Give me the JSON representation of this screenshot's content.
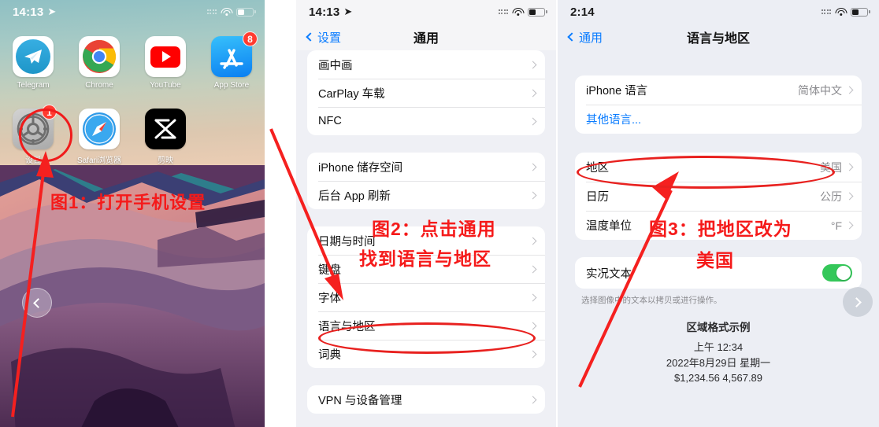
{
  "panels": {
    "home": {
      "status": {
        "time": "14:13",
        "location_icon": "location-arrow-icon"
      },
      "apps_row1": [
        {
          "name": "Telegram",
          "icon": "telegram-icon",
          "badge": ""
        },
        {
          "name": "Chrome",
          "icon": "chrome-icon",
          "badge": ""
        },
        {
          "name": "YouTube",
          "icon": "youtube-icon",
          "badge": ""
        },
        {
          "name": "App Store",
          "icon": "app-store-icon",
          "badge": "8"
        }
      ],
      "apps_row2": [
        {
          "name": "设置",
          "icon": "settings-gear-icon",
          "badge": "1"
        },
        {
          "name": "Safari浏览器",
          "icon": "safari-compass-icon",
          "badge": ""
        },
        {
          "name": "剪映",
          "icon": "jianying-icon",
          "badge": ""
        }
      ],
      "annotation": "图1：打开手机设置",
      "nav_prev_icon": "chevron-left-icon"
    },
    "general": {
      "status": {
        "time": "14:13",
        "location_icon": "location-arrow-icon"
      },
      "back_label": "设置",
      "title": "通用",
      "groups": [
        {
          "rows": [
            {
              "label": "画中画",
              "value": ""
            },
            {
              "label": "CarPlay 车载",
              "value": ""
            },
            {
              "label": "NFC",
              "value": ""
            }
          ]
        },
        {
          "rows": [
            {
              "label": "iPhone 储存空间",
              "value": ""
            },
            {
              "label": "后台 App 刷新",
              "value": ""
            }
          ]
        },
        {
          "rows": [
            {
              "label": "日期与时间",
              "value": ""
            },
            {
              "label": "键盘",
              "value": ""
            },
            {
              "label": "字体",
              "value": ""
            },
            {
              "label": "语言与地区",
              "value": ""
            },
            {
              "label": "词典",
              "value": ""
            }
          ]
        },
        {
          "rows": [
            {
              "label": "VPN 与设备管理",
              "value": ""
            }
          ]
        }
      ],
      "annotation_line1": "图2：点击通用",
      "annotation_line2": "找到语言与地区"
    },
    "lang": {
      "status": {
        "time": "2:14",
        "location_icon": ""
      },
      "back_label": "通用",
      "title": "语言与地区",
      "group_language": [
        {
          "label": "iPhone 语言",
          "value": "简体中文",
          "type": "disclosure"
        },
        {
          "label": "其他语言...",
          "value": "",
          "type": "link"
        }
      ],
      "group_region": [
        {
          "label": "地区",
          "value": "美国",
          "type": "disclosure"
        },
        {
          "label": "日历",
          "value": "公历",
          "type": "disclosure"
        },
        {
          "label": "温度单位",
          "value": "°F",
          "type": "disclosure"
        }
      ],
      "group_livetext": [
        {
          "label": "实况文本",
          "value": "on",
          "type": "toggle"
        }
      ],
      "livetext_footnote": "选择图像中的文本以拷贝或进行操作。",
      "sample": {
        "heading": "区域格式示例",
        "line1": "上午 12:34",
        "line2": "2022年8月29日 星期一",
        "line3": "$1,234.56    4,567.89"
      },
      "annotation_line1": "图3：把地区改为",
      "annotation_line2": "美国",
      "nav_next_icon": "chevron-right-icon"
    }
  },
  "colors": {
    "annotation_red": "#f5201f",
    "ios_blue": "#0a7cff",
    "toggle_green": "#34c759",
    "badge_red": "#ff3b30"
  }
}
